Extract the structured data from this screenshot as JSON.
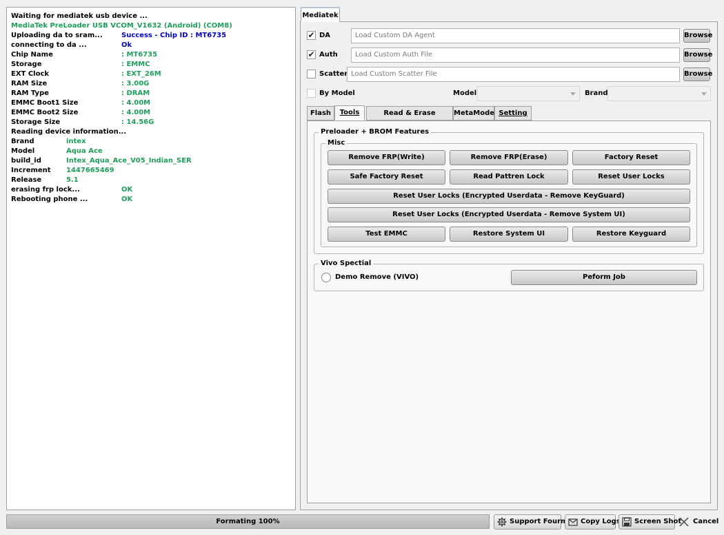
{
  "log": {
    "lines": [
      {
        "key": "Waiting for mediatek usb device ...",
        "value": ""
      },
      {
        "key": "MediaTek PreLoader USB VCOM_V1632 (Android) (COM8)",
        "value": ""
      },
      {
        "key": "Uploading da to sram...",
        "value": "Success - Chip ID  : MT6735"
      },
      {
        "key": "connecting to da ...",
        "value": "Ok"
      },
      {
        "key": "Chip Name",
        "value": ": MT6735"
      },
      {
        "key": "Storage",
        "value": ": EMMC"
      },
      {
        "key": "EXT Clock",
        "value": ": EXT_26M"
      },
      {
        "key": "RAM Size",
        "value": ": 3.00G"
      },
      {
        "key": "RAM Type",
        "value": ": DRAM"
      },
      {
        "key": "EMMC Boot1 Size",
        "value": ": 4.00M"
      },
      {
        "key": "EMMC Boot2 Size",
        "value": ": 4.00M"
      },
      {
        "key": "Storage Size",
        "value": ": 14.56G"
      },
      {
        "key": "Reading device information...",
        "value": ""
      },
      {
        "key": "Brand",
        "value": "intex"
      },
      {
        "key": "Model",
        "value": "Aqua Ace"
      },
      {
        "key": "build_id",
        "value": "Intex_Aqua_Ace_V05_Indian_SER"
      },
      {
        "key": "Increment",
        "value": "1447665469"
      },
      {
        "key": "Release",
        "value": "5.1"
      },
      {
        "key": "erasing frp lock...",
        "value": "OK"
      },
      {
        "key": "Rebooting phone ...",
        "value": "OK"
      }
    ]
  },
  "mediatek_tab": {
    "label": "Mediatek"
  },
  "da": {
    "label": "DA",
    "checked": true,
    "placeholder": "Load Custom DA Agent",
    "browse": "Browse"
  },
  "auth": {
    "label": "Auth",
    "checked": true,
    "placeholder": "Load Custom Auth File",
    "browse": "Browse"
  },
  "scatter": {
    "label": "Scatter",
    "checked": false,
    "placeholder": "Load Custom Scatter File",
    "browse": "Browse"
  },
  "by_model": {
    "label": "By Model",
    "checked": false,
    "model_label": "Model",
    "brand_label": "Brand"
  },
  "subtabs": {
    "flash": "Flash",
    "tools": "Tools",
    "read_erase": "Read & Erase Operation",
    "metamode": "MetaMode",
    "setting": "Setting"
  },
  "preloader_group": {
    "title": "Preloader + BROM Features"
  },
  "misc_group": {
    "title": "Misc",
    "remove_frp_write": "Remove FRP(Write)",
    "remove_frp_erase": "Remove FRP(Erase)",
    "factory_reset": "Factory Reset",
    "safe_factory_reset": "Safe Factory Reset",
    "read_pattern_lock": "Read Pattren Lock",
    "reset_user_locks": "Reset User Locks",
    "reset_keyguard": "Reset User Locks (Encrypted Userdata - Remove KeyGuard)",
    "reset_system_ui": "Reset User Locks (Encrypted Userdata - Remove System UI)",
    "test_emmc": "Test EMMC",
    "restore_system_ui": "Restore System UI",
    "restore_keyguard": "Restore Keyguard"
  },
  "vivo_group": {
    "title": "Vivo Spectial",
    "demo_remove": "Demo Remove (VIVO)",
    "perform_job": "Peform Job"
  },
  "status": {
    "progress_text": "Formating 100%",
    "progress_percent": 100
  },
  "footer": {
    "support": "Support Fourm",
    "copy_logs": "Copy Logs",
    "screenshot": "Screen Shot",
    "cancel": "Cancel"
  },
  "colors": {
    "green": "#1e9e5a",
    "blue": "#0000c8"
  }
}
